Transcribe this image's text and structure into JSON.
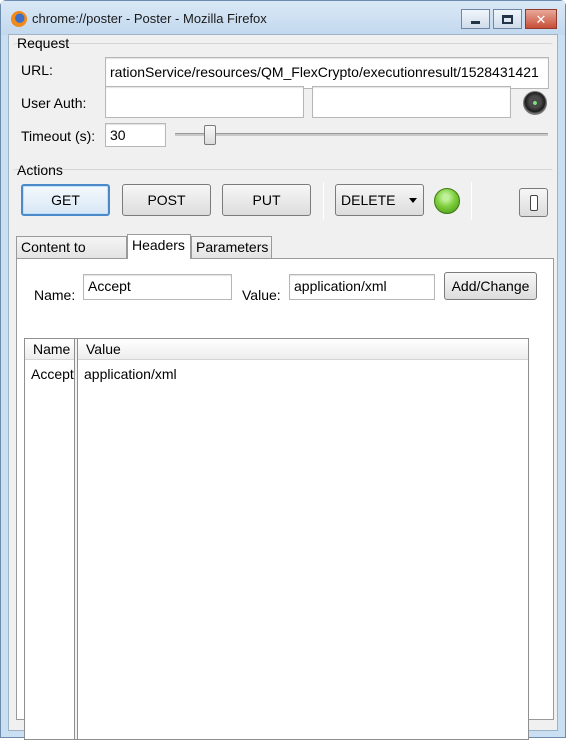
{
  "window": {
    "title": "chrome://poster - Poster - Mozilla Firefox"
  },
  "request": {
    "section_label": "Request",
    "url_label": "URL:",
    "url_value": "rationService/resources/QM_FlexCrypto/executionresult/1528431421",
    "user_auth_label": "User Auth:",
    "user_value": "",
    "password_value": "",
    "timeout_label": "Timeout (s):",
    "timeout_value": "30"
  },
  "actions": {
    "section_label": "Actions",
    "get_label": "GET",
    "post_label": "POST",
    "put_label": "PUT",
    "method_dropdown_value": "DELETE"
  },
  "tabs": [
    {
      "label": "Content to Send"
    },
    {
      "label": "Headers"
    },
    {
      "label": "Parameters"
    }
  ],
  "headers_tab": {
    "name_label": "Name:",
    "name_value": "Accept",
    "value_label": "Value:",
    "value_value": "application/xml",
    "add_change_label": "Add/Change",
    "columns": [
      "Name",
      "Value"
    ],
    "rows": [
      {
        "name": "Accept",
        "value": "application/xml"
      }
    ]
  }
}
